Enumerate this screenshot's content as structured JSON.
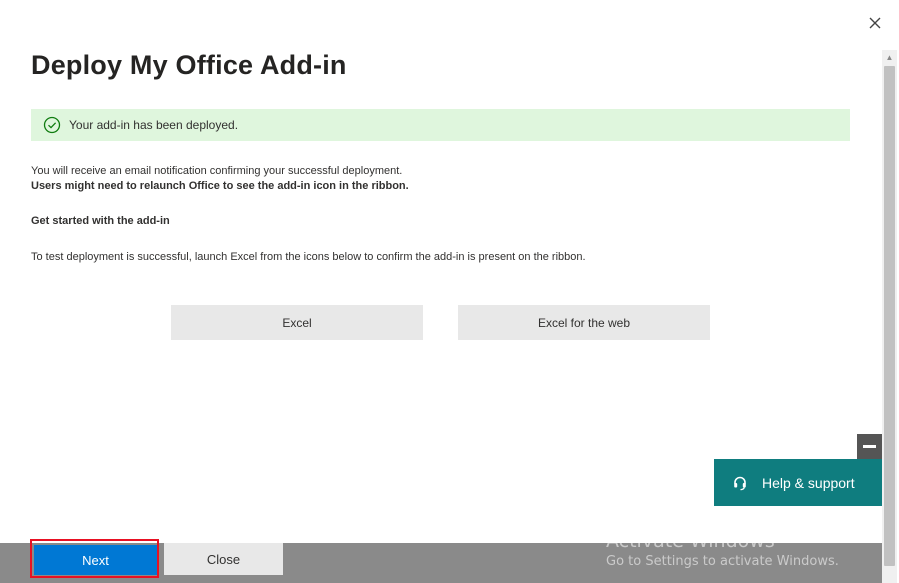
{
  "dialog": {
    "title": "Deploy My Office Add-in",
    "success_message": "Your add-in has been deployed.",
    "email_notice": "You will receive an email notification confirming your successful deployment.",
    "relaunch_notice": "Users might need to relaunch Office to see the add-in icon in the ribbon.",
    "get_started_heading": "Get started with the add-in",
    "test_instructions": "To test deployment is successful, launch Excel from the icons below to confirm the add-in is present on the ribbon."
  },
  "launch_buttons": [
    {
      "label": "Excel"
    },
    {
      "label": "Excel for the web"
    }
  ],
  "help": {
    "label": "Help & support"
  },
  "footer": {
    "next_label": "Next",
    "close_label": "Close"
  },
  "watermark": {
    "line1": "Activate Windows",
    "line2": "Go to Settings to activate Windows."
  },
  "colors": {
    "primary": "#0078d4",
    "success_bg": "#dff6dd",
    "success_icon": "#107c10",
    "help_bg": "#0f7d7f",
    "highlight": "#e81123"
  },
  "icons": {
    "close": "close-icon",
    "success": "checkmark-circle-icon",
    "help": "headset-icon",
    "minimize": "minimize-icon"
  }
}
